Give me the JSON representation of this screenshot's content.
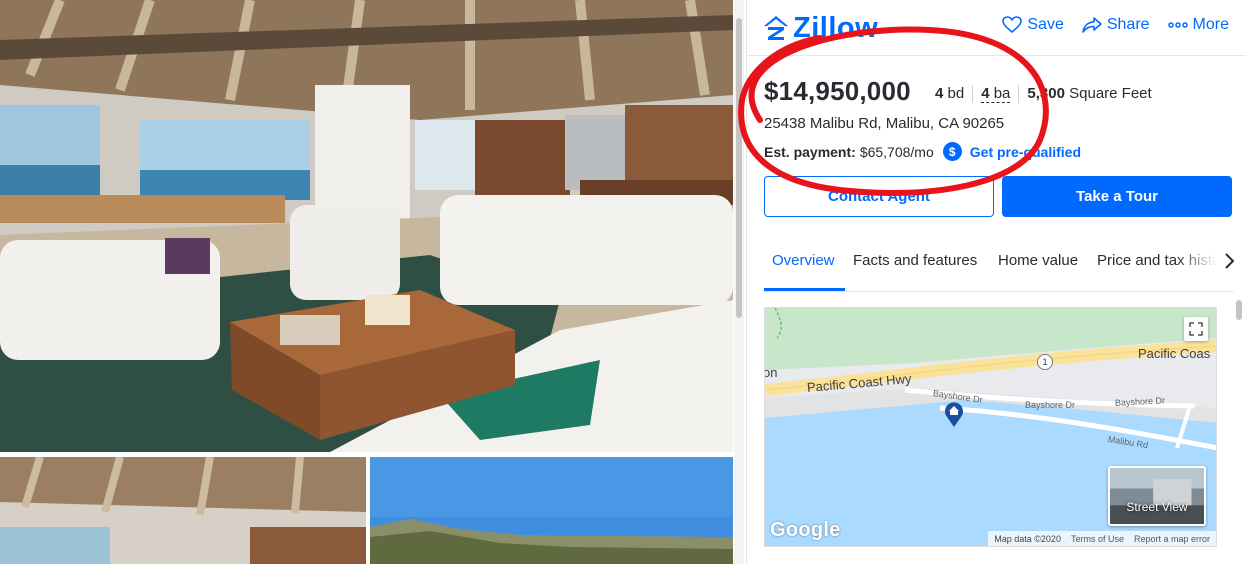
{
  "brand": {
    "name": "Zillow",
    "color": "#006aff"
  },
  "header_actions": [
    {
      "label": "Save",
      "icon": "heart-icon"
    },
    {
      "label": "Share",
      "icon": "share-icon"
    },
    {
      "label": "More",
      "icon": "ellipsis-icon"
    }
  ],
  "listing": {
    "price": "$14,950,000",
    "beds_value": "4",
    "beds_unit": "bd",
    "baths_value": "4",
    "baths_unit": "ba",
    "sqft_value": "5,300",
    "sqft_unit": "Square Feet",
    "address": "25438 Malibu Rd, Malibu, CA 90265",
    "est_payment_label": "Est. payment:",
    "est_payment_value": "$65,708/mo",
    "prequalify_link": "Get pre-qualified"
  },
  "buttons": {
    "contact": "Contact Agent",
    "tour": "Take a Tour"
  },
  "tabs": [
    {
      "label": "Overview",
      "active": true
    },
    {
      "label": "Facts and features",
      "active": false
    },
    {
      "label": "Home value",
      "active": false
    },
    {
      "label": "Price and tax history",
      "active": false
    }
  ],
  "map": {
    "labels": {
      "pch_left": "Pacific Coast Hwy",
      "pch_right": "Pacific Coas",
      "bayshore_1": "Bayshore Dr",
      "bayshore_2": "Bayshore Dr",
      "bayshore_3": "Bayshore Dr",
      "malibu_rd": "Malibu Rd",
      "partial": "on",
      "route": "1"
    },
    "street_view": "Street View",
    "google": "Google",
    "footer": {
      "data": "Map data ©2020",
      "terms": "Terms of Use",
      "report": "Report a map error"
    }
  },
  "colors": {
    "accent": "#006aff",
    "annotation": "#e8141b",
    "ocean": "#aadaff",
    "land": "#e8eaed",
    "park": "#c8e6c9"
  }
}
